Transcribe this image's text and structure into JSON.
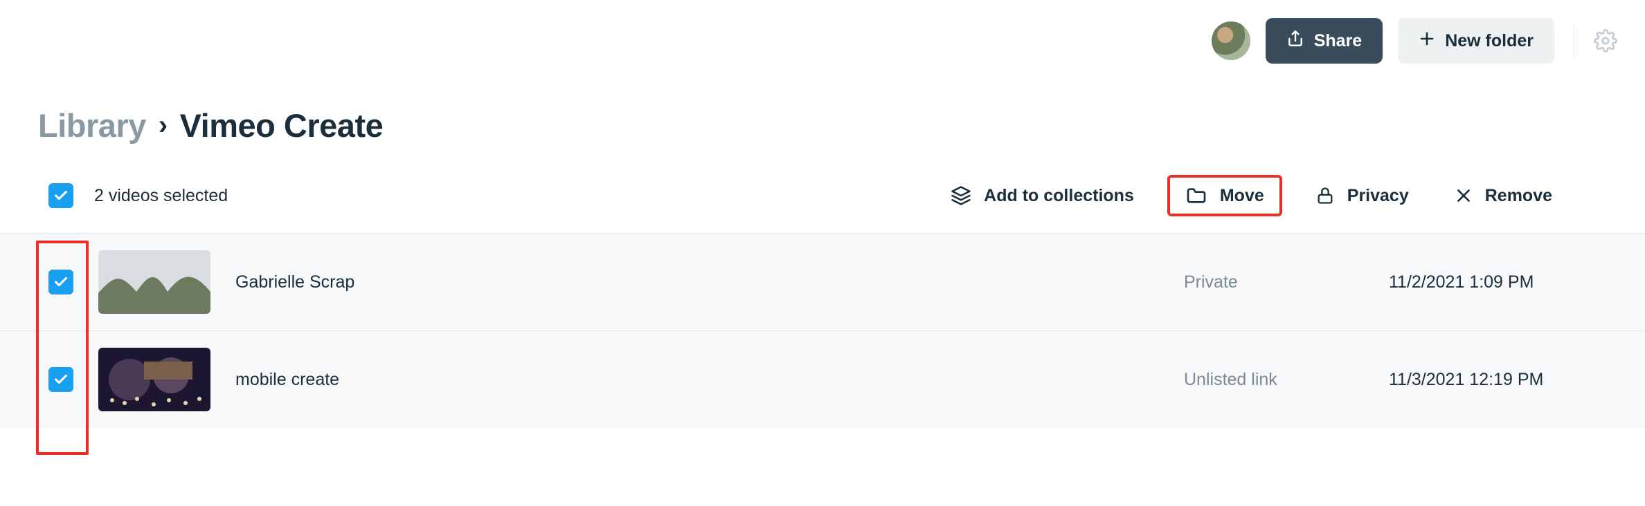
{
  "header": {
    "share_label": "Share",
    "new_folder_label": "New folder"
  },
  "breadcrumb": {
    "root": "Library",
    "current": "Vimeo Create"
  },
  "selection": {
    "summary": "2 videos selected"
  },
  "actions": {
    "add_to_collections": "Add to collections",
    "move": "Move",
    "privacy": "Privacy",
    "remove": "Remove"
  },
  "columns": {
    "title_key": "title",
    "privacy_key": "privacy",
    "date_key": "date"
  },
  "rows": [
    {
      "title": "Gabrielle Scrap",
      "privacy": "Private",
      "date": "11/2/2021 1:09 PM"
    },
    {
      "title": "mobile create",
      "privacy": "Unlisted link",
      "date": "11/3/2021 12:19 PM"
    }
  ]
}
